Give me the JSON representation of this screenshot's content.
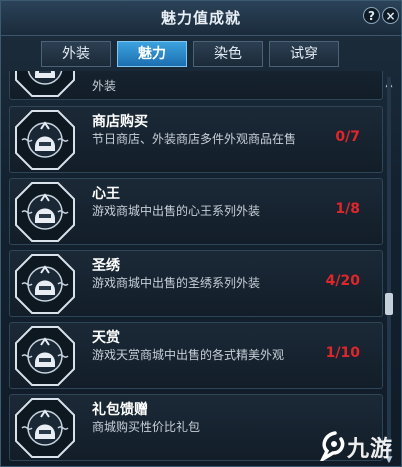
{
  "window": {
    "title": "魅力值成就"
  },
  "titlebar_buttons": {
    "help": "?",
    "close": "×"
  },
  "tabs": [
    {
      "label": "外装",
      "active": false
    },
    {
      "label": "魅力",
      "active": true
    },
    {
      "label": "染色",
      "active": false
    },
    {
      "label": "试穿",
      "active": false
    }
  ],
  "achievements": [
    {
      "title": "",
      "desc": "外装",
      "progress": ""
    },
    {
      "title": "商店购买",
      "desc": "节日商店、外装商店多件外观商品在售",
      "progress": "0/7"
    },
    {
      "title": "心王",
      "desc": "游戏商城中出售的心王系列外装",
      "progress": "1/8"
    },
    {
      "title": "圣绣",
      "desc": "游戏商城中出售的圣绣系列外装",
      "progress": "4/20"
    },
    {
      "title": "天赏",
      "desc": "游戏天赏商城中出售的各式精美外观",
      "progress": "1/10"
    },
    {
      "title": "礼包馈赠",
      "desc": "商城购买性价比礼包",
      "progress": ""
    }
  ],
  "colors": {
    "accent": "#2a8ed0",
    "progress": "#e0262b"
  },
  "watermark": {
    "text": "九游"
  }
}
